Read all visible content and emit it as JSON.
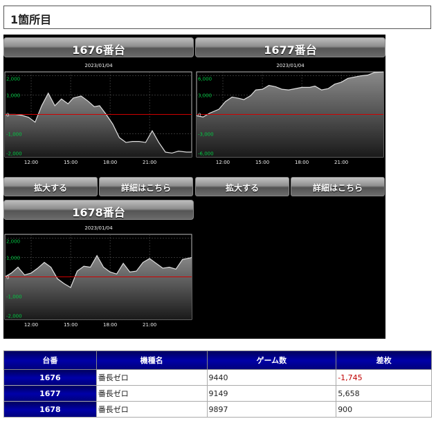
{
  "heading": "1箇所目",
  "labels": {
    "zoom": "拡大する",
    "detail": "詳細はこちら"
  },
  "chart_data": [
    {
      "type": "area",
      "title": "1676番台",
      "date": "2023/01/04",
      "yticks": [
        2000,
        1000,
        0,
        -1000,
        -2000
      ],
      "ytick_labels": [
        "2,000",
        "1,000",
        "0",
        "-1,000",
        "-2,000"
      ],
      "xticks": [
        12,
        15,
        18,
        21
      ],
      "xtick_labels": [
        "12:00",
        "15:00",
        "18:00",
        "21:00"
      ],
      "xlim": [
        10,
        24.2
      ],
      "ylim": [
        -2200,
        2200
      ],
      "x": [
        10,
        10.8,
        11.3,
        11.8,
        12.3,
        12.8,
        13.3,
        13.8,
        14.3,
        14.8,
        15.2,
        15.8,
        16.3,
        16.8,
        17.2,
        17.7,
        18.2,
        18.7,
        19.2,
        19.7,
        20.2,
        20.7,
        21.2,
        21.7,
        22.2,
        22.7,
        23.2,
        23.8,
        24.2
      ],
      "y": [
        0,
        0,
        -50,
        -150,
        -400,
        450,
        1100,
        450,
        800,
        550,
        850,
        950,
        700,
        400,
        450,
        0,
        -500,
        -1200,
        -1450,
        -1400,
        -1400,
        -1450,
        -850,
        -1450,
        -1950,
        -2000,
        -1900,
        -1950,
        -1950
      ]
    },
    {
      "type": "area",
      "title": "1677番台",
      "date": "2023/01/04",
      "yticks": [
        6000,
        3000,
        0,
        -3000,
        -6000
      ],
      "ytick_labels": [
        "6,000",
        "3,000",
        "0",
        "-3,000",
        "-6,000"
      ],
      "xticks": [
        12,
        15,
        18,
        21
      ],
      "xtick_labels": [
        "12:00",
        "15:00",
        "18:00",
        "21:00"
      ],
      "xlim": [
        10,
        24.2
      ],
      "ylim": [
        -6600,
        6600
      ],
      "x": [
        10,
        10.5,
        11,
        11.7,
        12.2,
        12.7,
        13.2,
        13.6,
        14.1,
        14.5,
        15,
        15.5,
        16,
        16.5,
        17,
        17.5,
        18,
        18.6,
        19,
        19.5,
        20,
        20.5,
        21,
        21.5,
        22,
        22.5,
        23,
        23.5,
        24.2
      ],
      "y": [
        -200,
        -400,
        200,
        800,
        2000,
        2700,
        2500,
        2300,
        2900,
        3800,
        3900,
        4500,
        4300,
        3900,
        3800,
        4000,
        4200,
        4200,
        4400,
        3800,
        4000,
        4700,
        5000,
        5600,
        5800,
        6000,
        6100,
        6500,
        6600
      ]
    },
    {
      "type": "area",
      "title": "1678番台",
      "date": "2023/01/04",
      "yticks": [
        2000,
        1000,
        0,
        -1000,
        -2000
      ],
      "ytick_labels": [
        "2,000",
        "1,000",
        "0",
        "-1,000",
        "-2,000"
      ],
      "xticks": [
        12,
        15,
        18,
        21
      ],
      "xtick_labels": [
        "12:00",
        "15:00",
        "18:00",
        "21:00"
      ],
      "xlim": [
        10,
        24.2
      ],
      "ylim": [
        -2200,
        2200
      ],
      "x": [
        10,
        10.5,
        11,
        11.5,
        12,
        12.5,
        13,
        13.5,
        14,
        14.5,
        15,
        15.5,
        16,
        16.5,
        17,
        17.5,
        18,
        18.5,
        19,
        19.5,
        20,
        20.5,
        21,
        21.5,
        22,
        22.5,
        23,
        23.5,
        24.2
      ],
      "y": [
        0,
        200,
        500,
        100,
        200,
        450,
        750,
        500,
        -100,
        -350,
        -550,
        300,
        550,
        500,
        1100,
        500,
        250,
        150,
        700,
        250,
        300,
        750,
        950,
        700,
        450,
        500,
        400,
        900,
        1000
      ]
    }
  ],
  "table": {
    "headers": [
      "台番",
      "機種名",
      "ゲーム数",
      "差枚"
    ],
    "rows": [
      {
        "num": "1676",
        "name": "番長ゼロ",
        "games": "9440",
        "diff": "-1,745"
      },
      {
        "num": "1677",
        "name": "番長ゼロ",
        "games": "9149",
        "diff": "5,658"
      },
      {
        "num": "1678",
        "name": "番長ゼロ",
        "games": "9897",
        "diff": "900"
      }
    ]
  }
}
